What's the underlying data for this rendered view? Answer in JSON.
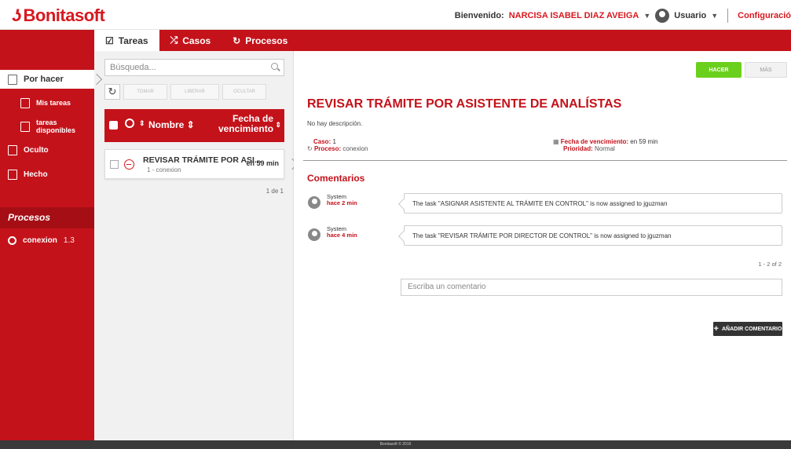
{
  "header": {
    "logo": "Bonitasoft",
    "welcome_label": "Bienvenido:",
    "user_name": "NARCISA ISABEL DIAZ AVEIGA",
    "user_menu_label": "Usuario",
    "config_label": "Configuració"
  },
  "tabs": [
    {
      "label": "Tareas",
      "icon": "check-square-icon"
    },
    {
      "label": "Casos",
      "icon": "shuffle-icon"
    },
    {
      "label": "Procesos",
      "icon": "process-icon"
    }
  ],
  "sidebar": {
    "items": [
      {
        "label": "Por hacer",
        "icon": "inbox-icon"
      },
      {
        "label": "Mis tareas",
        "icon": "my-tasks-icon"
      },
      {
        "label": "tareas disponibles",
        "icon": "available-tasks-icon"
      },
      {
        "label": "Oculto",
        "icon": "hidden-icon"
      },
      {
        "label": "Hecho",
        "icon": "done-icon"
      }
    ],
    "processes_header": "Procesos",
    "process": {
      "name": "conexion",
      "version": "1.3"
    }
  },
  "list": {
    "search_placeholder": "Búsqueda...",
    "buttons": {
      "take": "TOMAR",
      "release": "LIBERAR",
      "hide": "OCULTAR"
    },
    "columns": {
      "name": "Nombre",
      "due": "Fecha de vencimiento"
    },
    "tasks": [
      {
        "name": "REVISAR TRÁMITE POR ASI...",
        "sub": "1 - conexion",
        "due": "en 59 min"
      }
    ],
    "pagination": "1 de 1"
  },
  "detail": {
    "do_button": "HACER",
    "more_button": "MÁS",
    "title": "REVISAR TRÁMITE POR ASISTENTE DE ANALÍSTAS",
    "description": "No hay descripción.",
    "case_label": "Caso:",
    "case_value": "1",
    "process_label": "Proceso:",
    "process_value": "conexion",
    "due_label": "Fecha de vencimiento:",
    "due_value": "en 59 min",
    "priority_label": "Prioridad:",
    "priority_value": "Normal",
    "comments_header": "Comentarios",
    "comments": [
      {
        "author": "System",
        "ago": "hace 2 min",
        "text": "The task \"ASIGNAR ASISTENTE AL TRÁMITE EN CONTROL\" is now assigned to jguzman"
      },
      {
        "author": "System",
        "ago": "hace 4 min",
        "text": "The task \"REVISAR TRÁMITE POR DIRECTOR DE CONTROL\" is now assigned to jguzman"
      }
    ],
    "comments_pagination": "1 - 2 of 2",
    "comment_placeholder": "Escriba un comentario",
    "add_comment_button": "AÑADIR COMENTARIO"
  },
  "footer": {
    "text": "Bonitasoft © 2016"
  },
  "colors": {
    "brand_red": "#c4121a",
    "do_green": "#6bd01d"
  }
}
